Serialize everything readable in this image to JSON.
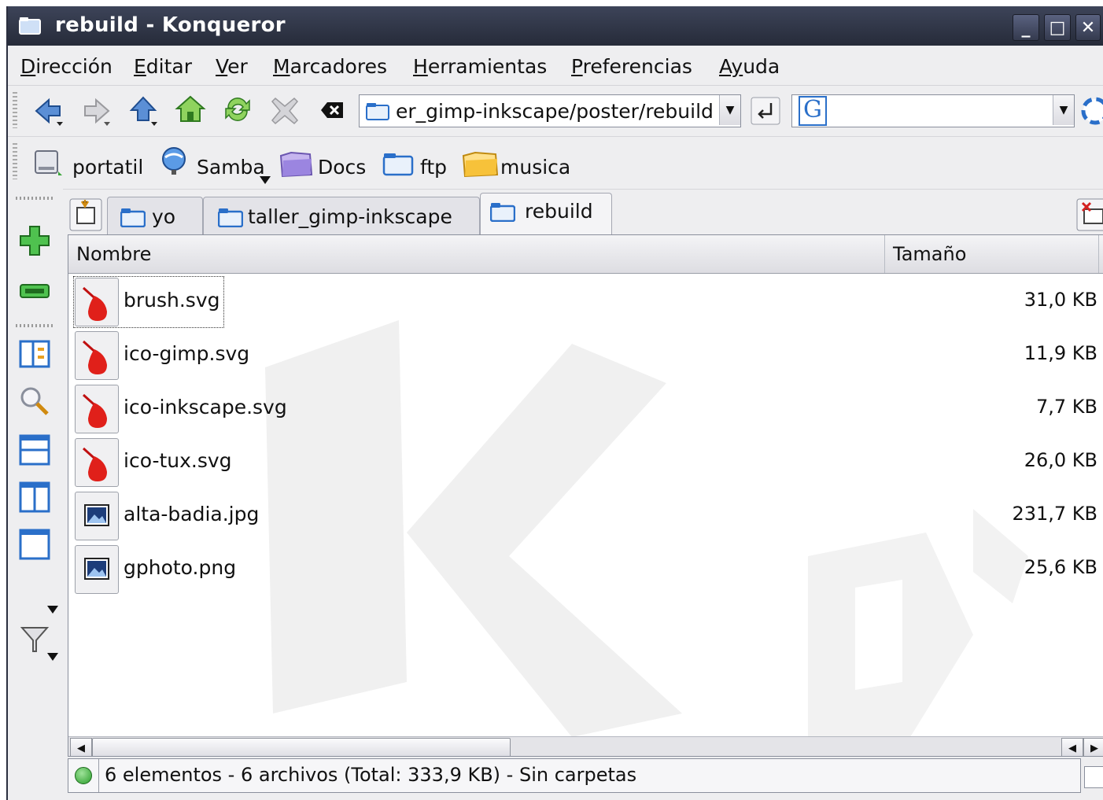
{
  "window": {
    "title": "rebuild - Konqueror",
    "controls": [
      "_",
      "□",
      "✕"
    ]
  },
  "menu": [
    {
      "first": "D",
      "rest": "irección"
    },
    {
      "first": "E",
      "rest": "ditar"
    },
    {
      "first": "V",
      "rest": "er"
    },
    {
      "first": "M",
      "rest": "arcadores"
    },
    {
      "first": "H",
      "rest": "erramientas"
    },
    {
      "first": "P",
      "rest": "referencias"
    },
    {
      "first": "Ay",
      "rest": "uda"
    }
  ],
  "toolbar": {
    "location": "er_gimp-inkscape/poster/rebuild",
    "search_engine": "G",
    "icons": [
      "back-icon",
      "forward-icon",
      "up-icon",
      "home-icon",
      "reload-icon",
      "stop-icon",
      "clear-location-icon",
      "go-icon",
      "google-search-icon"
    ]
  },
  "bookmarks": [
    {
      "label": "portatil",
      "icon": "drive-icon"
    },
    {
      "label": "Samba",
      "icon": "network-icon"
    },
    {
      "label": "Docs",
      "icon": "folder-purple-icon"
    },
    {
      "label": "ftp",
      "icon": "folder-icon"
    },
    {
      "label": "musica",
      "icon": "folder-yellow-icon"
    }
  ],
  "tabs": [
    {
      "label": "yo"
    },
    {
      "label": "taller_gimp-inkscape"
    },
    {
      "label": "rebuild",
      "active": true
    }
  ],
  "columns": {
    "name": "Nombre",
    "size": "Tamaño"
  },
  "files": [
    {
      "name": "brush.svg",
      "size": "31,0 KB",
      "cut": "(",
      "type": "svg"
    },
    {
      "name": "ico-gimp.svg",
      "size": "11,9 KB",
      "cut": "(",
      "type": "svg"
    },
    {
      "name": "ico-inkscape.svg",
      "size": "7,7 KB",
      "cut": "(",
      "type": "svg"
    },
    {
      "name": "ico-tux.svg",
      "size": "26,0 KB",
      "cut": "(",
      "type": "svg"
    },
    {
      "name": "alta-badia.jpg",
      "size": "231,7 KB",
      "cut": "I",
      "type": "image"
    },
    {
      "name": "gphoto.png",
      "size": "25,6 KB",
      "cut": "I",
      "type": "image"
    }
  ],
  "status": "6 elementos - 6 archivos (Total: 333,9 KB) - Sin carpetas",
  "colors": {
    "titlebar": "#2f3446",
    "accent": "#2a6fc9",
    "svg_icon": "#e0201a"
  }
}
